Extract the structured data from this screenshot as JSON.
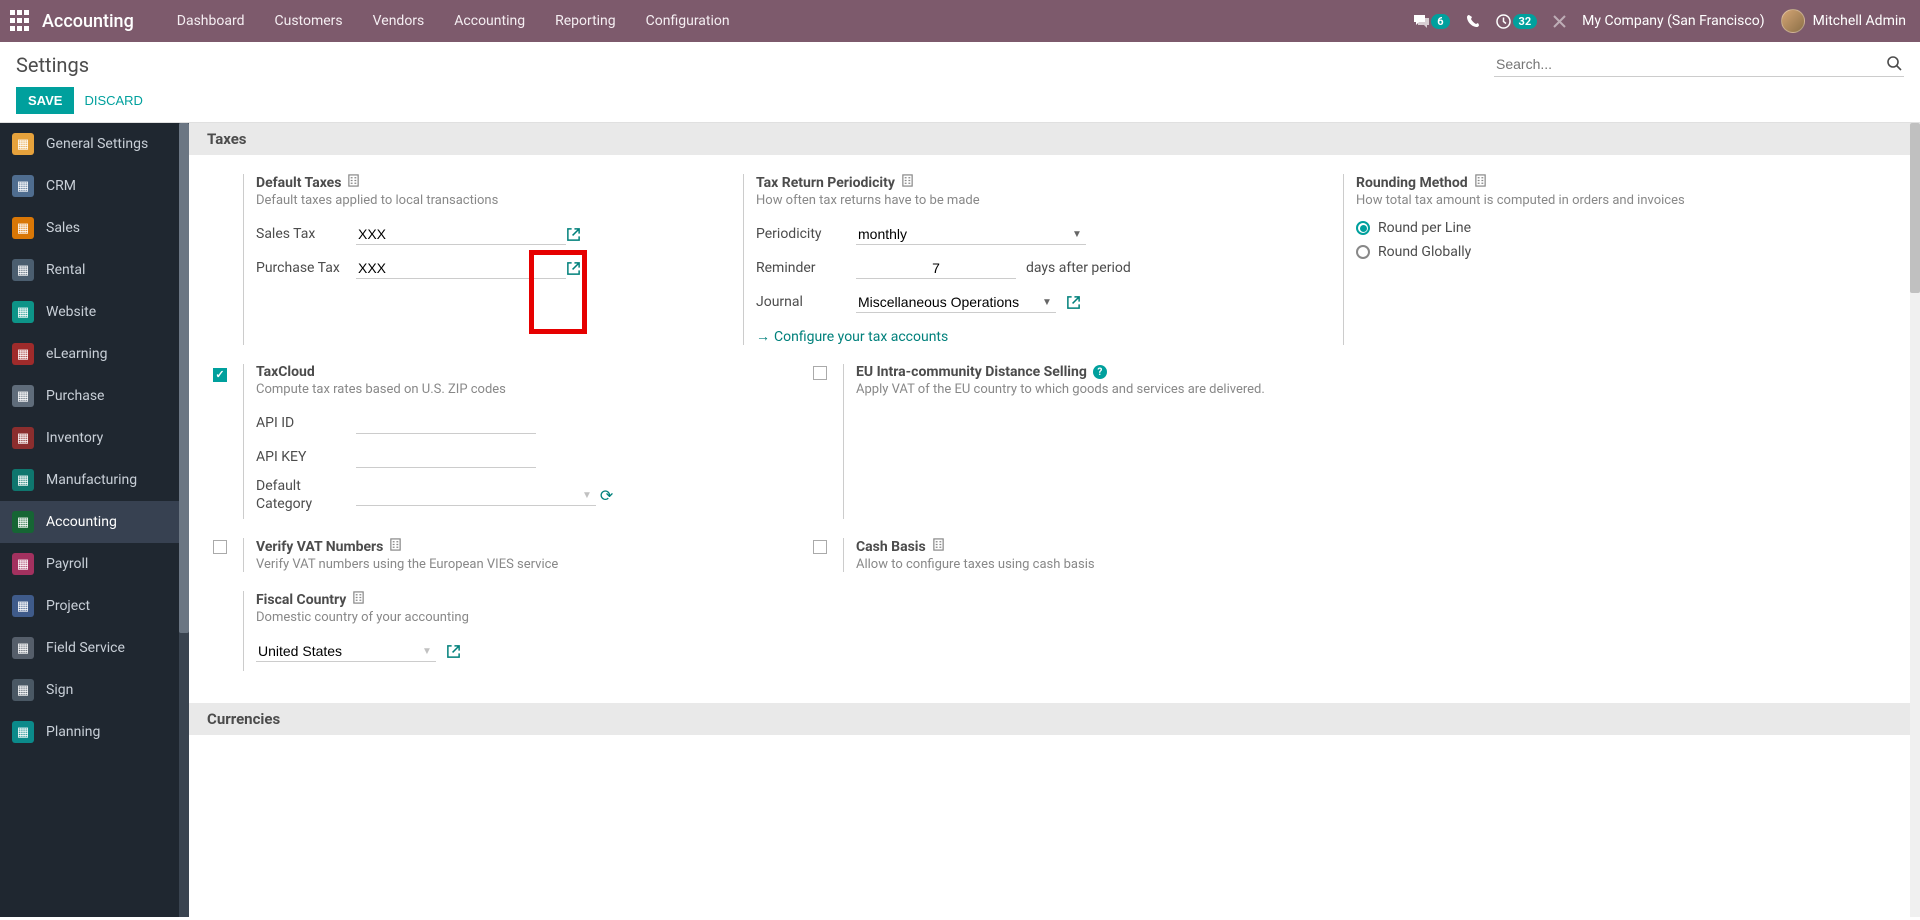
{
  "nav": {
    "brand": "Accounting",
    "items": [
      "Dashboard",
      "Customers",
      "Vendors",
      "Accounting",
      "Reporting",
      "Configuration"
    ],
    "badges": {
      "messages": "6",
      "activities": "32"
    },
    "company": "My Company (San Francisco)",
    "user": "Mitchell Admin"
  },
  "page": {
    "title": "Settings",
    "search_placeholder": "Search...",
    "save": "Save",
    "discard": "Discard"
  },
  "sidebar": {
    "items": [
      {
        "label": "General Settings",
        "color": "#e6a23c"
      },
      {
        "label": "CRM",
        "color": "#4f6d8f"
      },
      {
        "label": "Sales",
        "color": "#d97706"
      },
      {
        "label": "Rental",
        "color": "#4b5e6f"
      },
      {
        "label": "Website",
        "color": "#0d9488"
      },
      {
        "label": "eLearning",
        "color": "#9f2b2b"
      },
      {
        "label": "Purchase",
        "color": "#5f6c7a"
      },
      {
        "label": "Inventory",
        "color": "#8b2e2e"
      },
      {
        "label": "Manufacturing",
        "color": "#0f766e"
      },
      {
        "label": "Accounting",
        "color": "#166534"
      },
      {
        "label": "Payroll",
        "color": "#a3315f"
      },
      {
        "label": "Project",
        "color": "#3f5b8a"
      },
      {
        "label": "Field Service",
        "color": "#555e6a"
      },
      {
        "label": "Sign",
        "color": "#4a5864"
      },
      {
        "label": "Planning",
        "color": "#0b8a8a"
      }
    ],
    "active_index": 9
  },
  "sections": {
    "taxes_header": "Taxes",
    "currencies_header": "Currencies",
    "default_taxes": {
      "title": "Default Taxes",
      "desc": "Default taxes applied to local transactions",
      "sales_label": "Sales Tax",
      "sales_value": "XXX",
      "purchase_label": "Purchase Tax",
      "purchase_value": "XXX"
    },
    "tax_return": {
      "title": "Tax Return Periodicity",
      "desc": "How often tax returns have to be made",
      "periodicity_label": "Periodicity",
      "periodicity_value": "monthly",
      "reminder_label": "Reminder",
      "reminder_value": "7",
      "reminder_suffix": "days after period",
      "journal_label": "Journal",
      "journal_value": "Miscellaneous Operations",
      "configure_link": "Configure your tax accounts"
    },
    "rounding": {
      "title": "Rounding Method",
      "desc": "How total tax amount is computed in orders and invoices",
      "opt1": "Round per Line",
      "opt2": "Round Globally"
    },
    "taxcloud": {
      "title": "TaxCloud",
      "desc": "Compute tax rates based on U.S. ZIP codes",
      "api_id_label": "API ID",
      "api_key_label": "API KEY",
      "default_cat_label": "Default Category"
    },
    "eu_distance": {
      "title": "EU Intra-community Distance Selling",
      "desc": "Apply VAT of the EU country to which goods and services are delivered."
    },
    "verify_vat": {
      "title": "Verify VAT Numbers",
      "desc": "Verify VAT numbers using the European VIES service"
    },
    "cash_basis": {
      "title": "Cash Basis",
      "desc": "Allow to configure taxes using cash basis"
    },
    "fiscal_country": {
      "title": "Fiscal Country",
      "desc": "Domestic country of your accounting",
      "value": "United States"
    }
  }
}
